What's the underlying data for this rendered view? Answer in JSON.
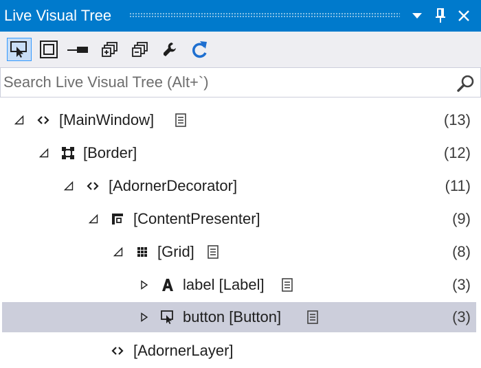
{
  "window": {
    "title": "Live Visual Tree",
    "buttons": [
      "dropdown-icon",
      "pin-icon",
      "close-icon"
    ]
  },
  "toolbar": {
    "tools": [
      {
        "name": "select-element-icon",
        "active": true
      },
      {
        "name": "display-layout-adorners-icon",
        "active": false
      },
      {
        "name": "track-focused-element-icon",
        "active": false
      },
      {
        "name": "show-just-my-xaml-icon",
        "active": false
      },
      {
        "name": "expand-all-icon",
        "active": false
      },
      {
        "name": "wrench-icon",
        "active": false
      },
      {
        "name": "refresh-icon",
        "active": false
      }
    ]
  },
  "search": {
    "placeholder": "Search Live Visual Tree (Alt+`)",
    "value": ""
  },
  "tree": {
    "nodes": [
      {
        "label": "[MainWindow]",
        "count": "(13)",
        "expander": "expanded",
        "icon": "xaml-tag-icon",
        "props": true,
        "selected": false
      },
      {
        "label": "[Border]",
        "count": "(12)",
        "expander": "expanded",
        "icon": "border-icon",
        "props": false,
        "selected": false
      },
      {
        "label": "[AdornerDecorator]",
        "count": "(11)",
        "expander": "expanded",
        "icon": "xaml-tag-icon",
        "props": false,
        "selected": false
      },
      {
        "label": "[ContentPresenter]",
        "count": "(9)",
        "expander": "expanded",
        "icon": "content-presenter-icon",
        "props": false,
        "selected": false
      },
      {
        "label": "[Grid]",
        "count": "(8)",
        "expander": "expanded",
        "icon": "grid-icon",
        "props": true,
        "selected": false
      },
      {
        "label": "label [Label]",
        "count": "(3)",
        "expander": "collapsed",
        "icon": "label-icon",
        "props": true,
        "selected": false
      },
      {
        "label": "button [Button]",
        "count": "(3)",
        "expander": "collapsed",
        "icon": "button-icon",
        "props": true,
        "selected": true
      },
      {
        "label": "[AdornerLayer]",
        "count": "",
        "expander": "none",
        "icon": "xaml-tag-icon",
        "props": false,
        "selected": false
      }
    ]
  },
  "colors": {
    "title_bar": "#007acc",
    "toolbar_bg": "#eeeef2",
    "selected_row": "#cccedb",
    "active_tool": "#c9def5",
    "refresh_blue": "#1e6fd0"
  }
}
